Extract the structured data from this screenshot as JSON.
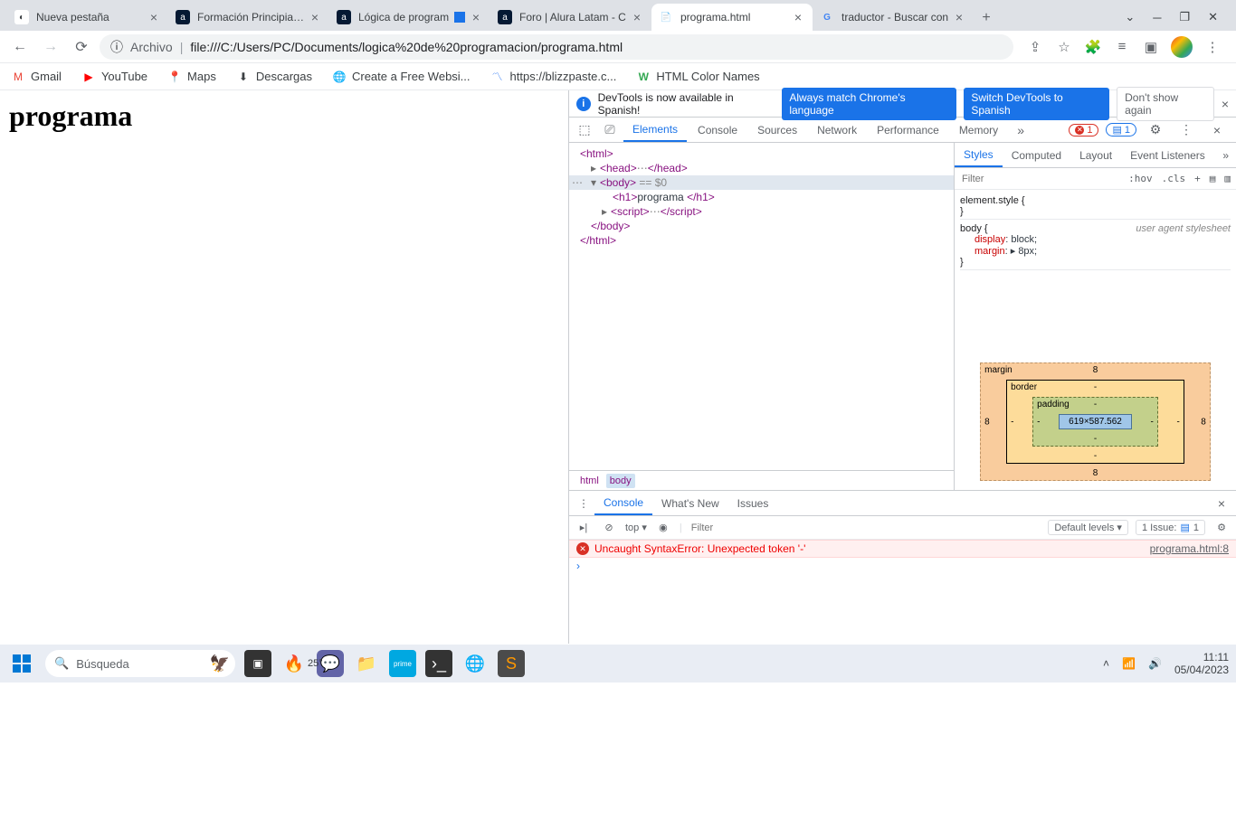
{
  "tabs": [
    {
      "title": "Nueva pestaña",
      "fav": "◐"
    },
    {
      "title": "Formación Principiante",
      "fav": "a"
    },
    {
      "title": "Lógica de program",
      "fav": "a"
    },
    {
      "title": "Foro | Alura Latam - C",
      "fav": "a"
    },
    {
      "title": "programa.html",
      "fav": "📄",
      "active": true
    },
    {
      "title": "traductor - Buscar con",
      "fav": "G"
    }
  ],
  "url": {
    "proto": "Archivo",
    "path": "file:///C:/Users/PC/Documents/logica%20de%20programacion/programa.html",
    "info": "ⓘ"
  },
  "bookmarks": [
    {
      "ic": "M",
      "label": "Gmail",
      "color": "#ea4335"
    },
    {
      "ic": "▶",
      "label": "YouTube",
      "color": "#ff0000"
    },
    {
      "ic": "📍",
      "label": "Maps",
      "color": "#34a853"
    },
    {
      "ic": "⬇",
      "label": "Descargas",
      "color": "#5f6368"
    },
    {
      "ic": "🌐",
      "label": "Create a Free Websi...",
      "color": "#5f6368"
    },
    {
      "ic": "〽",
      "label": "https://blizzpaste.c...",
      "color": "#4285f4"
    },
    {
      "ic": "W",
      "label": "HTML Color Names",
      "color": "#34a853"
    }
  ],
  "page": {
    "h1": "programa"
  },
  "banner": {
    "text": "DevTools is now available in Spanish!",
    "btn1": "Always match Chrome's language",
    "btn2": "Switch DevTools to Spanish",
    "btn3": "Don't show again"
  },
  "dtTabs": [
    "Elements",
    "Console",
    "Sources",
    "Network",
    "Performance",
    "Memory"
  ],
  "dtErrors": "1",
  "dtIssues": "1",
  "dom": {
    "html_open": "<html>",
    "head": "<head>",
    "head_close": "</head>",
    "dots": "⋯",
    "body_open": "<body>",
    "body_sel": "== $0",
    "h1_open": "<h1>",
    "h1_text": "programa ",
    "h1_close": "</h1>",
    "script_open": "<script>",
    "script_close": "</script>",
    "body_close": "</body>",
    "html_close": "</html>"
  },
  "stylesTabs": [
    "Styles",
    "Computed",
    "Layout",
    "Event Listeners"
  ],
  "filter": {
    "placeholder": "Filter",
    "hov": ":hov",
    "cls": ".cls"
  },
  "rules": {
    "r1": "element.style {",
    "r1c": "}",
    "r2sel": "body {",
    "r2ua": "user agent stylesheet",
    "r2p1": "display",
    "r2v1": ": block;",
    "r2p2": "margin",
    "r2v2": ": ▸ 8px;",
    "r2c": "}"
  },
  "box": {
    "margin": "margin",
    "border": "border",
    "padding": "padding",
    "size": "619×587.562",
    "m": "8",
    "b": "-",
    "p": "-"
  },
  "crumbs": {
    "html": "html",
    "body": "body"
  },
  "drawer": {
    "tabs": [
      "Console",
      "What's New",
      "Issues"
    ],
    "top": "top ▾",
    "filter": "Filter",
    "levels": "Default levels ▾",
    "issue": "1 Issue:",
    "issueCount": "1",
    "error": "Uncaught SyntaxError: Unexpected token '-'",
    "errorSrc": "programa.html:8",
    "prompt": "›"
  },
  "taskbar": {
    "search": "Búsqueda",
    "temp": "25°",
    "time": "11:11",
    "date": "05/04/2023"
  }
}
